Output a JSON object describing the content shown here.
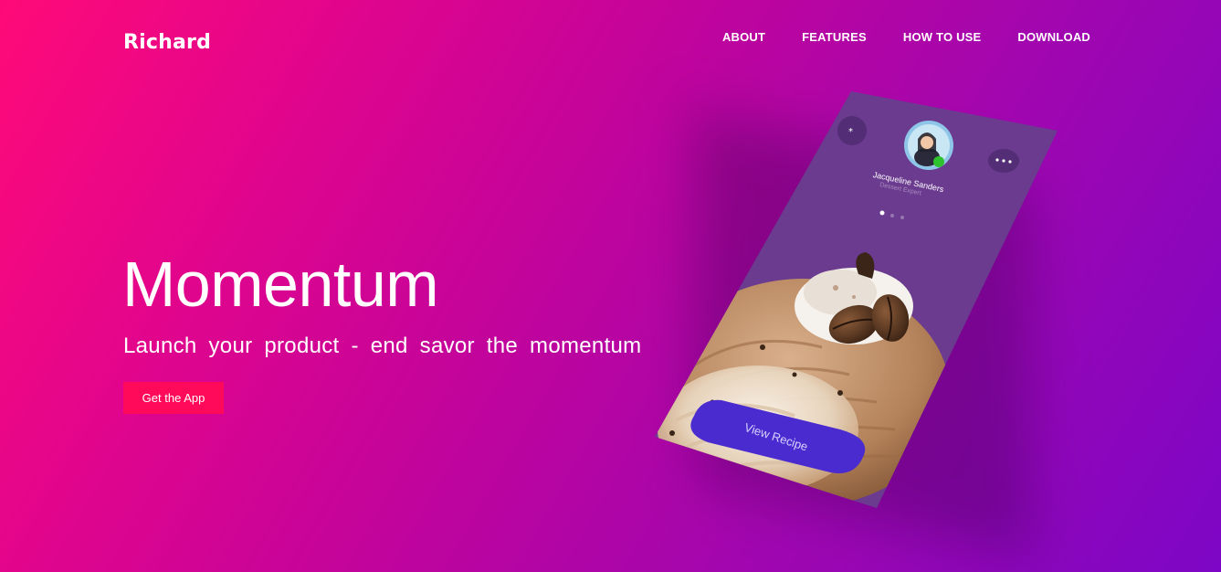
{
  "nav": {
    "brand": "Richard",
    "links": [
      "ABOUT",
      "FEATURES",
      "HOW TO USE",
      "DOWNLOAD"
    ]
  },
  "hero": {
    "title": "Momentum",
    "subtitle": "Launch your product - end savor the momentum",
    "cta_label": "Get the App"
  },
  "phone": {
    "profile_name": "Jacqueline Sanders",
    "profile_role": "Dessert Expert",
    "button_label": "View Recipe",
    "icons": [
      "star-icon",
      "more-icon"
    ]
  },
  "colors": {
    "gradient_start": "#ff0a78",
    "gradient_end": "#7d06c6",
    "cta": "#ff0a5a",
    "phone_screen": "#6a3a8c",
    "recipe_button": "#4a2bd0"
  }
}
